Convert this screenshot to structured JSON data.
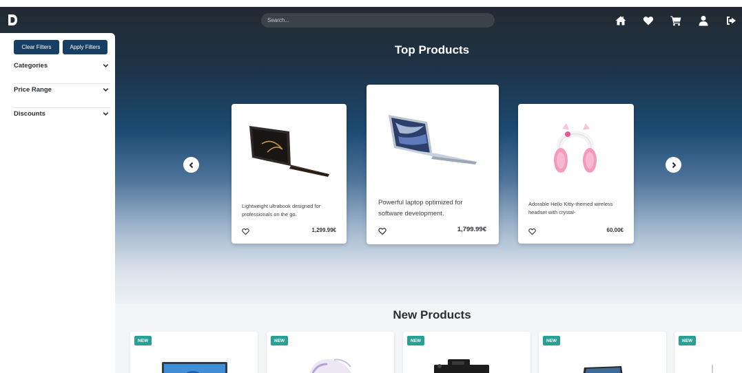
{
  "navbar": {
    "search_placeholder": "Search...",
    "icons": [
      "home-icon",
      "heart-icon",
      "cart-icon",
      "user-icon",
      "logout-icon"
    ]
  },
  "sidebar": {
    "clear_label": "Clear Filters",
    "apply_label": "Apply Filters",
    "filters": [
      {
        "label": "Categories"
      },
      {
        "label": "Price Range"
      },
      {
        "label": "Discounts"
      }
    ]
  },
  "top_products": {
    "title": "Top Products",
    "items": [
      {
        "desc": "Lightweight ultrabook designed for professionals on the go.",
        "price": "1,299.99€"
      },
      {
        "desc": "Powerful laptop optimized for software development.",
        "price": "1,799.99€"
      },
      {
        "desc": "Adorable Hello Kitty-themed wireless headset with crystal-",
        "price": "60.00€"
      }
    ]
  },
  "new_products": {
    "title": "New Products",
    "badge": "NEW"
  },
  "colors": {
    "primary": "#173f63",
    "badge": "#27a196"
  }
}
